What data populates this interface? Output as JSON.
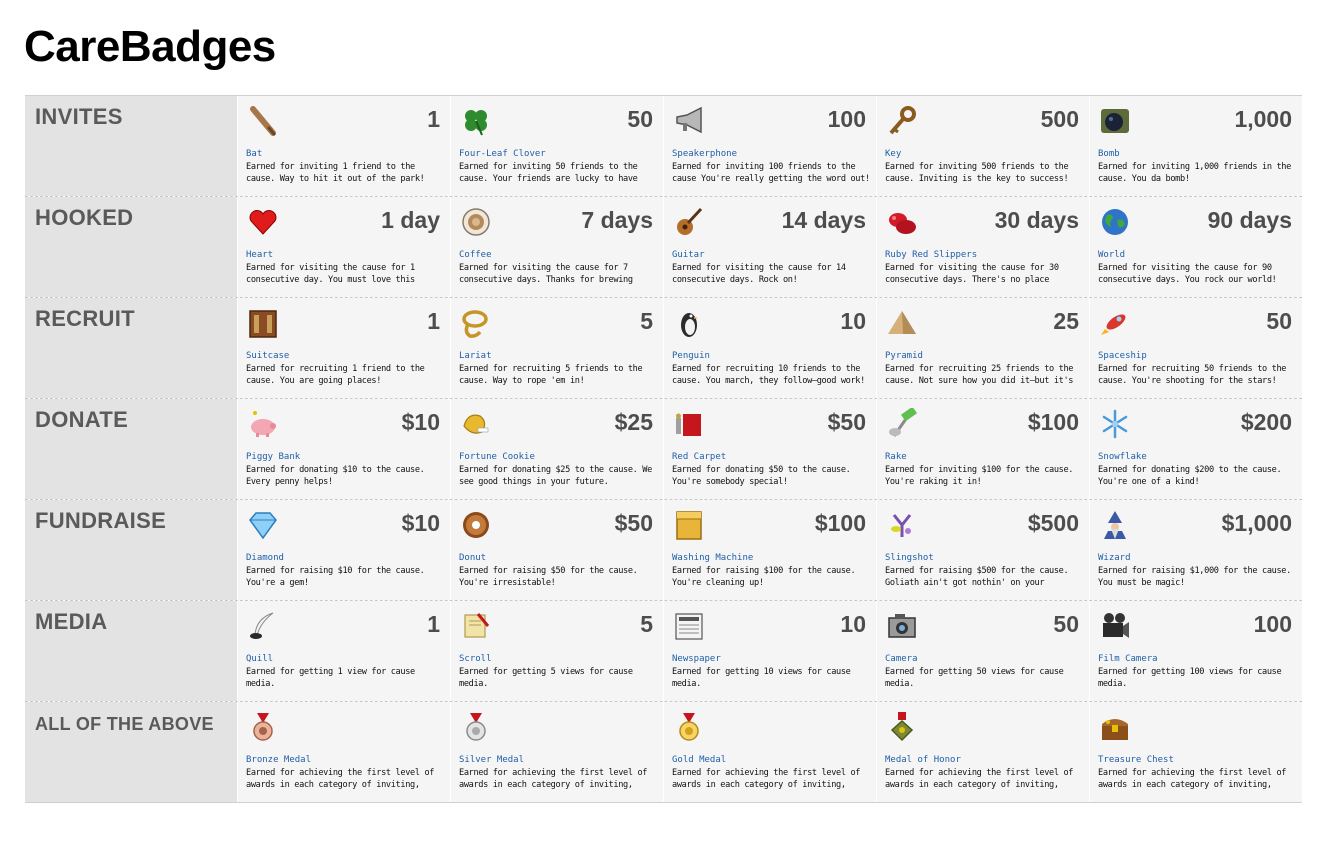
{
  "page": {
    "title": "CareBadges"
  },
  "rows": [
    {
      "category": "INVITES",
      "badges": [
        {
          "amount": "1",
          "name": "Bat",
          "icon": "bat-icon",
          "desc": "Earned for inviting 1 friend to the cause. Way to hit it out of the park!"
        },
        {
          "amount": "50",
          "name": "Four-Leaf Clover",
          "icon": "clover-icon",
          "desc": "Earned for inviting 50 friends to the cause. Your friends are lucky to have you!"
        },
        {
          "amount": "100",
          "name": "Speakerphone",
          "icon": "speakerphone-icon",
          "desc": "Earned for inviting 100 friends to the cause You're really getting the word out!"
        },
        {
          "amount": "500",
          "name": "Key",
          "icon": "key-icon",
          "desc": "Earned for inviting 500 friends to the cause. Inviting is the key to success!"
        },
        {
          "amount": "1,000",
          "name": "Bomb",
          "icon": "bomb-icon",
          "desc": "Earned for inviting 1,000 friends in the cause. You da bomb!"
        }
      ]
    },
    {
      "category": "HOOKED",
      "badges": [
        {
          "amount": "1 day",
          "name": "Heart",
          "icon": "heart-icon",
          "desc": "Earned for visiting the cause for 1 consecutive day. You must love this cause!"
        },
        {
          "amount": "7 days",
          "name": "Coffee",
          "icon": "coffee-icon",
          "desc": "Earned for visiting the cause for 7 consecutive days. Thanks for brewing support!"
        },
        {
          "amount": "14 days",
          "name": "Guitar",
          "icon": "guitar-icon",
          "desc": "Earned for visiting the cause for 14 consecutive days. Rock on!"
        },
        {
          "amount": "30 days",
          "name": "Ruby Red Slippers",
          "icon": "slippers-icon",
          "desc": "Earned for visiting the cause for 30 consecutive days. There's no place like..."
        },
        {
          "amount": "90 days",
          "name": "World",
          "icon": "world-icon",
          "desc": "Earned for visiting the cause for 90 consecutive days. You rock our world!"
        }
      ]
    },
    {
      "category": "RECRUIT",
      "badges": [
        {
          "amount": "1",
          "name": "Suitcase",
          "icon": "suitcase-icon",
          "desc": "Earned for recruiting 1 friend to the cause. You are going places!"
        },
        {
          "amount": "5",
          "name": "Lariat",
          "icon": "lariat-icon",
          "desc": "Earned for recruiting 5 friends to the cause. Way to rope 'em in!"
        },
        {
          "amount": "10",
          "name": "Penguin",
          "icon": "penguin-icon",
          "desc": "Earned for recruiting 10 friends to the cause. You march, they follow—good work!"
        },
        {
          "amount": "25",
          "name": "Pyramid",
          "icon": "pyramid-icon",
          "desc": "Earned for recruiting 25 friends to the cause. Not sure how you did it—but it's working!"
        },
        {
          "amount": "50",
          "name": "Spaceship",
          "icon": "spaceship-icon",
          "desc": "Earned for recruiting 50 friends to the cause. You're shooting for the stars!"
        }
      ]
    },
    {
      "category": "DONATE",
      "badges": [
        {
          "amount": "$10",
          "name": "Piggy Bank",
          "icon": "piggy-bank-icon",
          "desc": "Earned for donating $10 to the cause. Every penny helps!"
        },
        {
          "amount": "$25",
          "name": "Fortune Cookie",
          "icon": "fortune-cookie-icon",
          "desc": "Earned for donating $25 to the cause. We see good things in your future."
        },
        {
          "amount": "$50",
          "name": "Red Carpet",
          "icon": "red-carpet-icon",
          "desc": "Earned for donating $50 to the cause. You're somebody special!"
        },
        {
          "amount": "$100",
          "name": "Rake",
          "icon": "rake-icon",
          "desc": "Earned for inviting $100 for the cause. You're raking it in!"
        },
        {
          "amount": "$200",
          "name": "Snowflake",
          "icon": "snowflake-icon",
          "desc": "Earned for donating $200 to the cause. You're one of a kind!"
        }
      ]
    },
    {
      "category": "FUNDRAISE",
      "badges": [
        {
          "amount": "$10",
          "name": "Diamond",
          "icon": "diamond-icon",
          "desc": "Earned for raising $10 for the cause. You're a gem!"
        },
        {
          "amount": "$50",
          "name": "Donut",
          "icon": "donut-icon",
          "desc": "Earned for raising $50 for the cause. You're irresistable!"
        },
        {
          "amount": "$100",
          "name": "Washing Machine",
          "icon": "washing-machine-icon",
          "desc": "Earned for raising $100 for the cause. You're cleaning up!"
        },
        {
          "amount": "$500",
          "name": "Slingshot",
          "icon": "slingshot-icon",
          "desc": "Earned for raising $500 for the cause. Goliath ain't got nothin' on your efforts!"
        },
        {
          "amount": "$1,000",
          "name": "Wizard",
          "icon": "wizard-icon",
          "desc": "Earned for raising $1,000 for the cause. You must be magic!"
        }
      ]
    },
    {
      "category": "MEDIA",
      "badges": [
        {
          "amount": "1",
          "name": "Quill",
          "icon": "quill-icon",
          "desc": "Earned for getting 1 view for cause media."
        },
        {
          "amount": "5",
          "name": "Scroll",
          "icon": "scroll-icon",
          "desc": "Earned for getting 5 views for cause media."
        },
        {
          "amount": "10",
          "name": "Newspaper",
          "icon": "newspaper-icon",
          "desc": "Earned for getting 10 views for cause media."
        },
        {
          "amount": "50",
          "name": "Camera",
          "icon": "camera-icon",
          "desc": "Earned for getting 50 views for cause media."
        },
        {
          "amount": "100",
          "name": "Film Camera",
          "icon": "film-camera-icon",
          "desc": "Earned for getting 100 views for cause media."
        }
      ]
    },
    {
      "category": "ALL OF THE ABOVE",
      "badges": [
        {
          "amount": "",
          "name": "Bronze Medal",
          "icon": "bronze-medal-icon",
          "desc": "Earned for achieving the first level of awards in each category of inviting, recruiting..."
        },
        {
          "amount": "",
          "name": "Silver Medal",
          "icon": "silver-medal-icon",
          "desc": "Earned for achieving the first level of awards in each category of inviting, recruiting..."
        },
        {
          "amount": "",
          "name": "Gold Medal",
          "icon": "gold-medal-icon",
          "desc": "Earned for achieving the first level of awards in each category of inviting, recruiting..."
        },
        {
          "amount": "",
          "name": "Medal of Honor",
          "icon": "medal-of-honor-icon",
          "desc": "Earned for achieving the first level of awards in each category of inviting, recruiting..."
        },
        {
          "amount": "",
          "name": "Treasure Chest",
          "icon": "treasure-chest-icon",
          "desc": "Earned for achieving the first level of awards in each category of inviting, recruiting..."
        }
      ]
    }
  ],
  "colors": {
    "category_bg": "#e3e3e3",
    "cell_bg": "#f5f5f5",
    "category_text": "#5a5a5a",
    "badge_name": "#1f5fa8"
  }
}
